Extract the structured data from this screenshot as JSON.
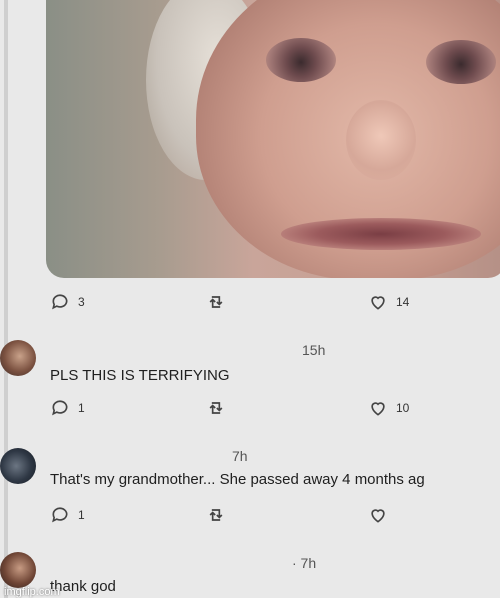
{
  "post": {
    "reply_count": "3",
    "like_count": "14"
  },
  "comments": [
    {
      "time": "15h",
      "text": "PLS THIS IS TERRIFYING",
      "reply_count": "1",
      "like_count": "10"
    },
    {
      "time": "7h",
      "text": "That's my grandmother... She passed away 4 months ag",
      "reply_count": "1",
      "like_count": ""
    },
    {
      "time": "· 7h",
      "text": "thank god"
    }
  ],
  "watermark": "imgflip.com",
  "icons": {
    "reply": "reply-icon",
    "retweet": "retweet-icon",
    "like": "heart-icon"
  }
}
